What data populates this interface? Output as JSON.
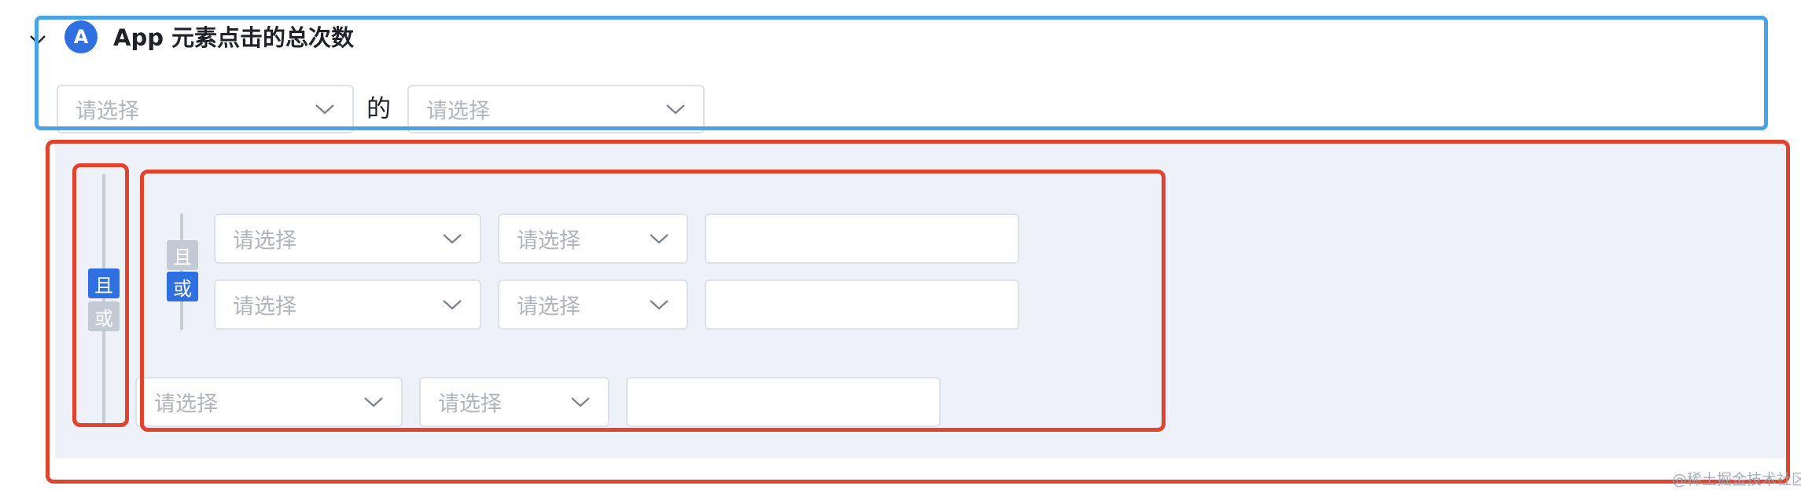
{
  "metric": {
    "badge": "A",
    "title": "App 元素点击的总次数",
    "connector": "的",
    "selects": [
      {
        "placeholder": "请选择"
      },
      {
        "placeholder": "请选择"
      }
    ]
  },
  "filters": {
    "outer_logic": {
      "and": "且",
      "or": "或",
      "selected": "且"
    },
    "inner_group": {
      "logic": {
        "and": "且",
        "or": "或",
        "selected": "或"
      },
      "conditions": [
        {
          "field": "请选择",
          "operator": "请选择",
          "value": ""
        },
        {
          "field": "请选择",
          "operator": "请选择",
          "value": ""
        }
      ]
    },
    "condition": {
      "field": "请选择",
      "operator": "请选择",
      "value": ""
    }
  },
  "watermark": "@稀土掘金技术社区",
  "colors": {
    "badge": "#2f6fe0",
    "logic_active": "#2f6fe0",
    "logic_inactive": "#c3cad6",
    "panel_bg": "#eef2f8",
    "annotation_blue": "#4aa3e6",
    "annotation_red": "#e0432e"
  },
  "icons": {
    "collapse": "chevron-down-icon",
    "select_arrow": "chevron-down-icon"
  }
}
